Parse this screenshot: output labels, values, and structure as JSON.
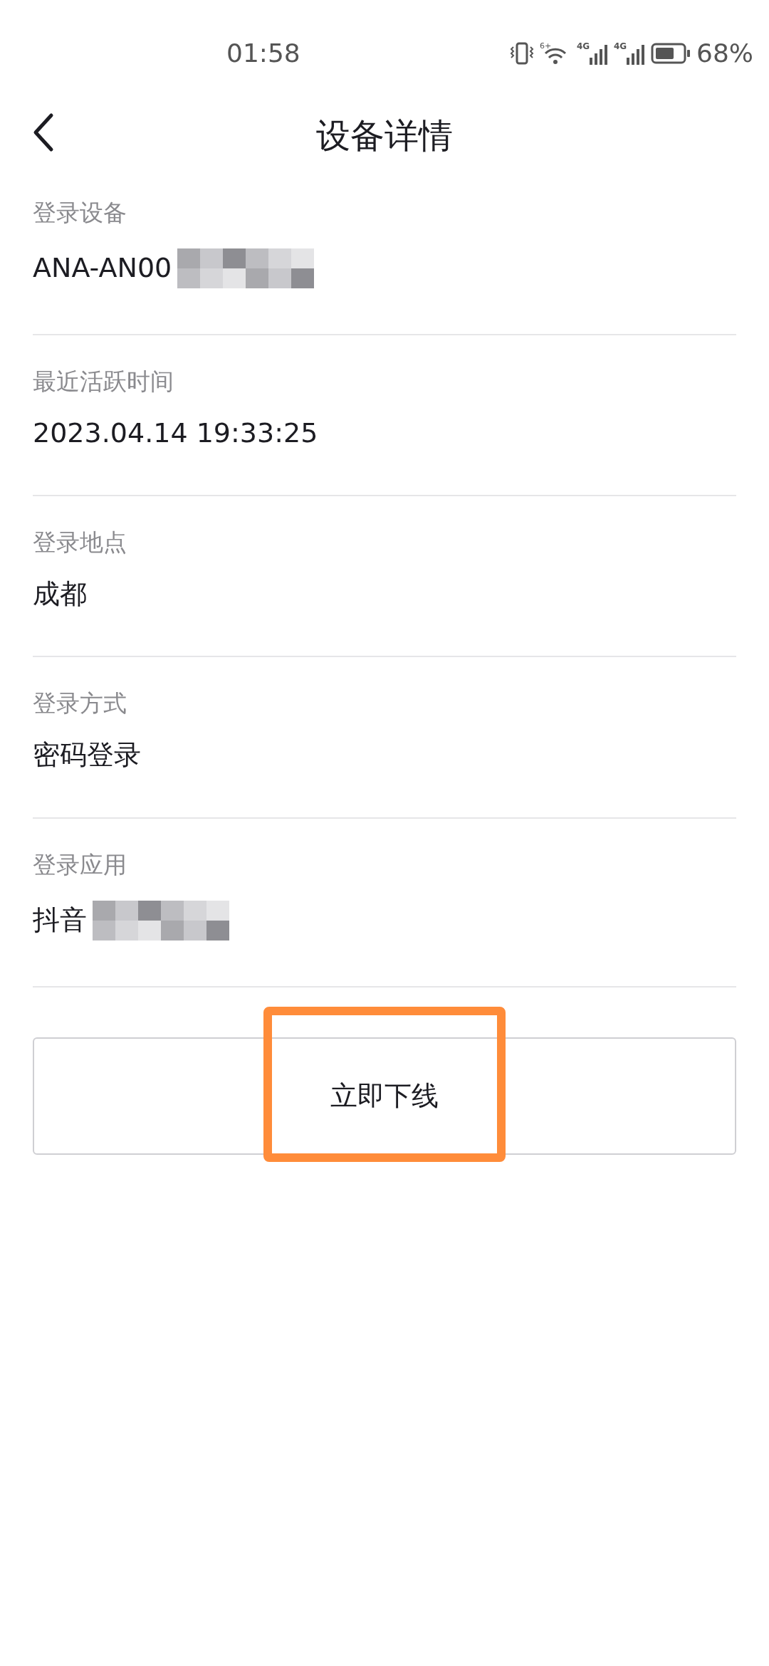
{
  "status_bar": {
    "time": "01:58",
    "battery_text": "68%",
    "net_labels": [
      "6+",
      "4G",
      "4G"
    ]
  },
  "header": {
    "title": "设备详情"
  },
  "details": [
    {
      "label": "登录设备",
      "value": "ANA-AN00",
      "redacted": true
    },
    {
      "label": "最近活跃时间",
      "value": "2023.04.14 19:33:25",
      "redacted": false
    },
    {
      "label": "登录地点",
      "value": "成都",
      "redacted": false
    },
    {
      "label": "登录方式",
      "value": "密码登录",
      "redacted": false
    },
    {
      "label": "登录应用",
      "value": "抖音",
      "redacted": true
    }
  ],
  "action_button": {
    "label": "立即下线",
    "highlighted": true
  }
}
